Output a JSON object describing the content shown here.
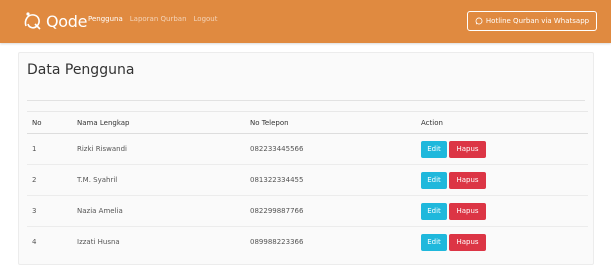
{
  "navbar": {
    "brand": "Qode",
    "links": [
      "Pengguna",
      "Laporan Qurban",
      "Logout"
    ],
    "whatsapp_button": "Hotline Qurban via Whatsapp",
    "color": "#e08a40"
  },
  "page": {
    "title": "Data Pengguna"
  },
  "table": {
    "headers": [
      "No",
      "Nama Lengkap",
      "No Telepon",
      "Action"
    ],
    "rows": [
      {
        "no": "1",
        "name": "Rizki Riswandi",
        "phone": "082233445566"
      },
      {
        "no": "2",
        "name": "T.M. Syahril",
        "phone": "081322334455"
      },
      {
        "no": "3",
        "name": "Nazia Amelia",
        "phone": "082299887766"
      },
      {
        "no": "4",
        "name": "Izzati Husna",
        "phone": "089988223366"
      }
    ],
    "edit_label": "Edit",
    "delete_label": "Hapus",
    "edit_color": "#1fb8dc",
    "delete_color": "#dc3545"
  }
}
